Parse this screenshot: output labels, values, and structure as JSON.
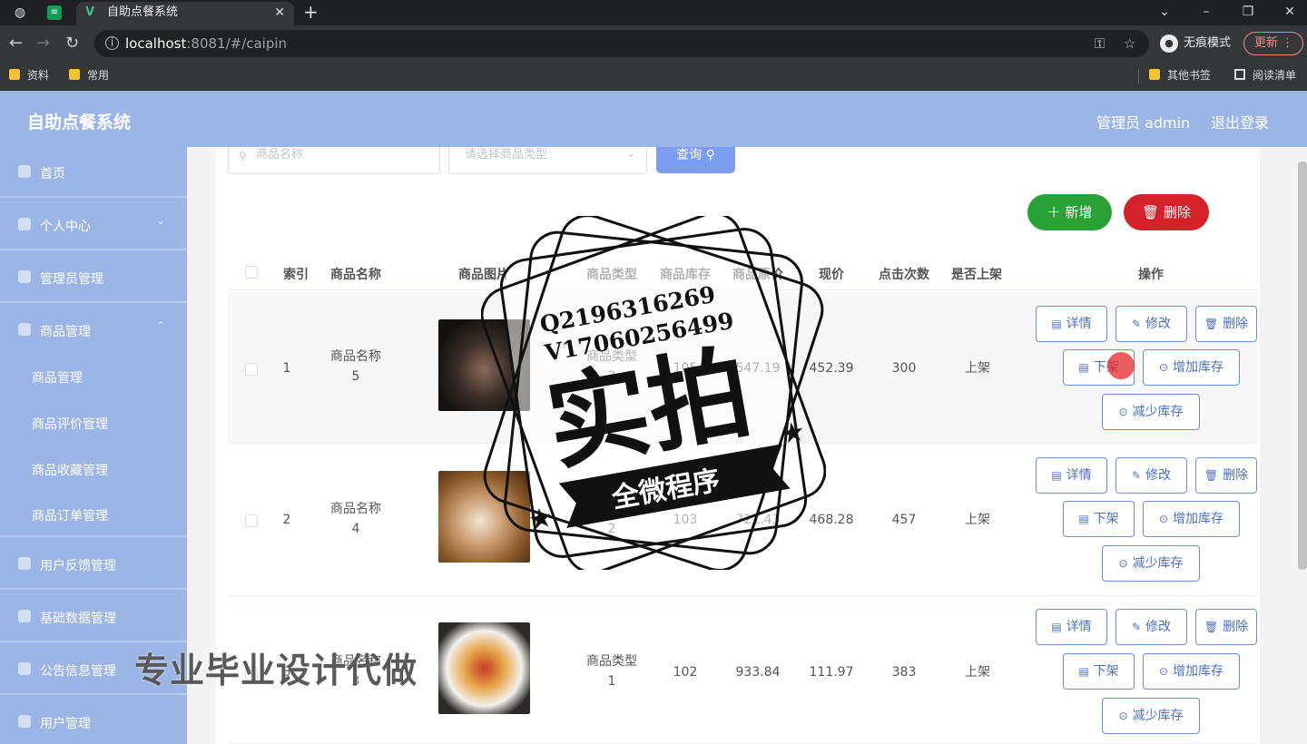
{
  "browser": {
    "tab_title": "自助点餐系统",
    "url_host": "localhost",
    "url_rest": ":8081/#/caipin",
    "incognito_label": "无痕模式",
    "update_label": "更新",
    "bookmarks": [
      "资料",
      "常用"
    ],
    "bookmarks_right": [
      "其他书签",
      "阅读清单"
    ]
  },
  "header": {
    "title": "自助点餐系统",
    "user": "管理员 admin",
    "logout": "退出登录"
  },
  "sidebar": {
    "items": [
      {
        "label": "首页",
        "icon": "home-icon"
      },
      {
        "label": "个人中心",
        "icon": "user-icon"
      },
      {
        "label": "管理员管理",
        "icon": "admin-icon"
      },
      {
        "label": "商品管理",
        "icon": "goods-icon"
      },
      {
        "label": "用户反馈管理",
        "icon": "feedback-icon"
      },
      {
        "label": "基础数据管理",
        "icon": "data-icon"
      },
      {
        "label": "公告信息管理",
        "icon": "notice-icon"
      },
      {
        "label": "用户管理",
        "icon": "users-icon"
      }
    ],
    "subitems": [
      "商品管理",
      "商品评价管理",
      "商品收藏管理",
      "商品订单管理"
    ]
  },
  "search": {
    "name_placeholder": "商品名称",
    "type_placeholder": "请选择商品类型",
    "query_label": "查询"
  },
  "actions": {
    "add_label": "新增",
    "delete_label": "删除"
  },
  "table": {
    "headers": [
      "索引",
      "商品名称",
      "商品图片",
      "商品类型",
      "商品库存",
      "商品原价",
      "现价",
      "点击次数",
      "是否上架",
      "操作"
    ],
    "rows": [
      {
        "index": "1",
        "name": "商品名称\n5",
        "type": "商品类型\n2",
        "stock": "105",
        "original": "547.19",
        "price": "452.39",
        "clicks": "300",
        "status": "上架"
      },
      {
        "index": "2",
        "name": "商品名称\n4",
        "type": "商品类型\n2",
        "stock": "103",
        "original": "721.43",
        "price": "468.28",
        "clicks": "457",
        "status": "上架"
      },
      {
        "index": "3",
        "name": "商品名称\n3",
        "type": "商品类型\n1",
        "stock": "102",
        "original": "933.84",
        "price": "111.97",
        "clicks": "383",
        "status": "上架"
      }
    ],
    "ops": {
      "detail": "详情",
      "edit": "修改",
      "delete": "删除",
      "off_shelf": "下架",
      "add_stock": "增加库存",
      "reduce_stock": "减少库存"
    }
  },
  "watermark": {
    "qq": "Q2196316269",
    "vx": "V17060256499",
    "big": "实拍",
    "ribbon": "全微程序",
    "bottom": "专业毕业设计代做"
  }
}
